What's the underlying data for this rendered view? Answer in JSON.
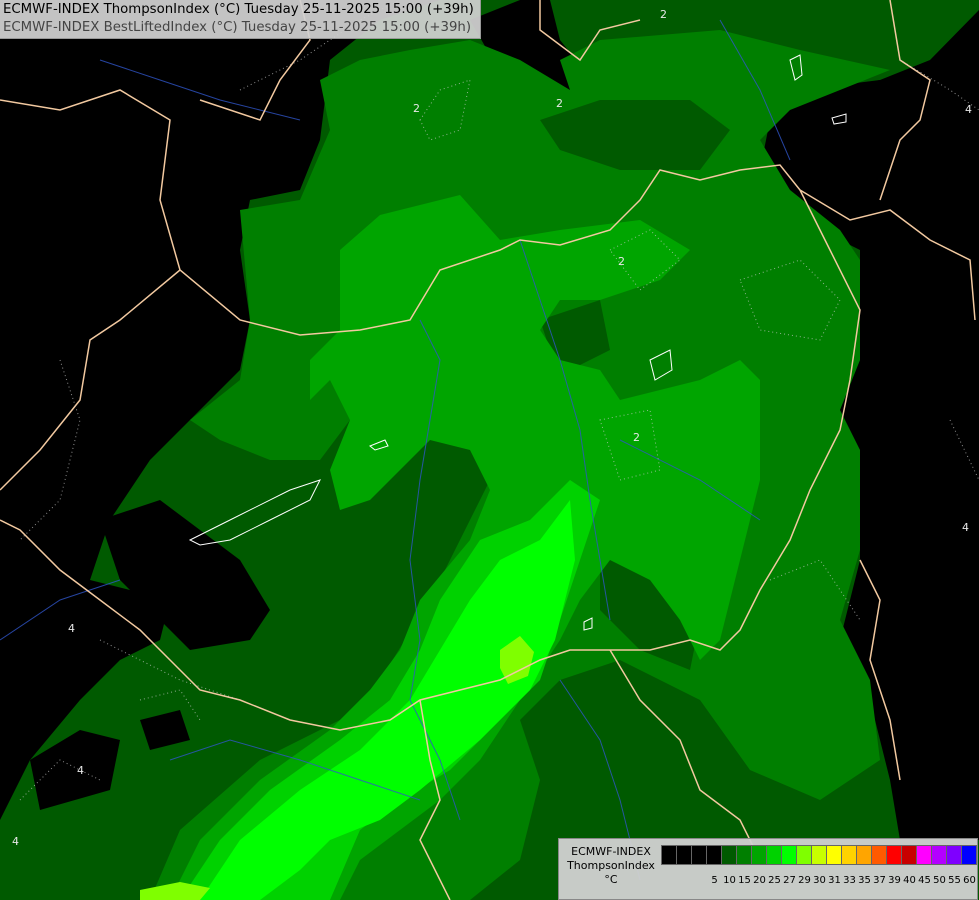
{
  "header": {
    "line1": "ECMWF-INDEX ThompsonIndex (°C) Tuesday 25-11-2025 15:00 (+39h)",
    "line2": "ECMWF-INDEX BestLiftedIndex (°C) Tuesday 25-11-2025 15:00 (+39h)"
  },
  "legend": {
    "title": "ECMWF-INDEX",
    "param": "ThompsonIndex",
    "unit": "°C",
    "ticks": [
      "5",
      "10",
      "15",
      "20",
      "25",
      "27",
      "29",
      "30",
      "31",
      "33",
      "35",
      "37",
      "39",
      "40",
      "45",
      "50",
      "55",
      "60"
    ],
    "colors": [
      "#000000",
      "#000000",
      "#000000",
      "#000000",
      "#005a00",
      "#007f00",
      "#00a500",
      "#00d200",
      "#00ff00",
      "#7fff00",
      "#c8ff00",
      "#ffff00",
      "#ffd200",
      "#ffa500",
      "#ff5a00",
      "#ff0000",
      "#c80000",
      "#ff00ff",
      "#b400ff",
      "#7f00ff",
      "#0000ff"
    ]
  },
  "contour_labels": [
    "2",
    "2",
    "2",
    "2",
    "4",
    "4",
    "4",
    "4",
    "4",
    "2"
  ]
}
